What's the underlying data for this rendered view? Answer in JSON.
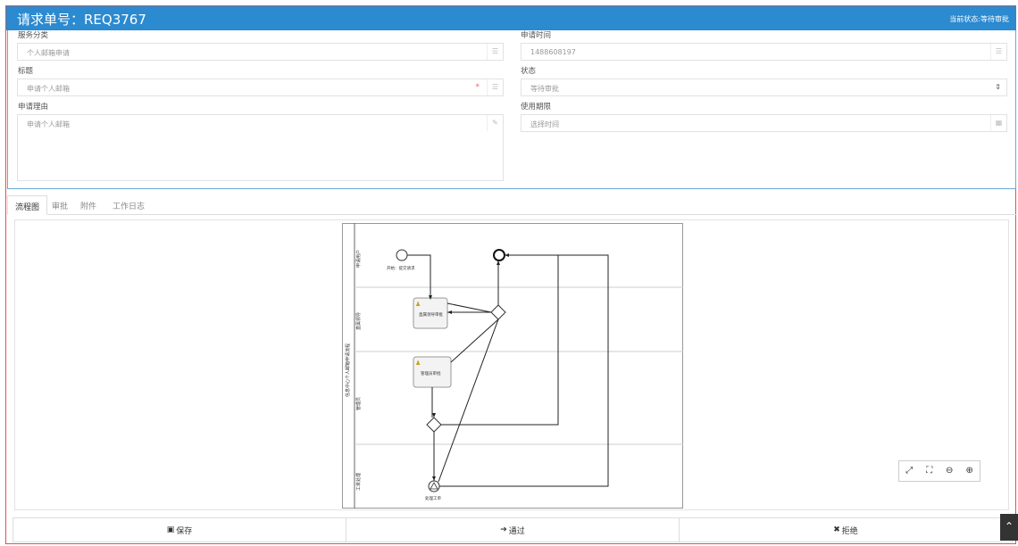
{
  "header": {
    "title": "请求单号：REQ3767",
    "status": "当前状态:等待审批"
  },
  "form": {
    "service_category": {
      "label": "服务分类",
      "value": "个人邮箱申请"
    },
    "title": {
      "label": "标题",
      "value": "申请个人邮箱",
      "required_mark": "*"
    },
    "reason": {
      "label": "申请理由",
      "value": "申请个人邮箱"
    },
    "apply_time": {
      "label": "申请时间",
      "value": "1488608197"
    },
    "status": {
      "label": "状态",
      "value": "等待审批"
    },
    "validity": {
      "label": "使用期限",
      "placeholder": "选择时间"
    }
  },
  "tabs": [
    "流程图",
    "审批",
    "附件",
    "工作日志"
  ],
  "diagram": {
    "start_label": "开始：提交请求",
    "task1": "直属领导审批",
    "task2": "管理员审批",
    "end_label": "处理工单",
    "lanes": [
      "申请用户",
      "直属领导",
      "管理员",
      "工单处理"
    ],
    "pool": "信息中心个人邮箱申请流程"
  },
  "zoom_icons": [
    "expand-icon",
    "fit-icon",
    "zoom-out-icon",
    "zoom-in-icon"
  ],
  "footer": {
    "save": "保存",
    "approve": "通过",
    "reject": "拒绝"
  }
}
